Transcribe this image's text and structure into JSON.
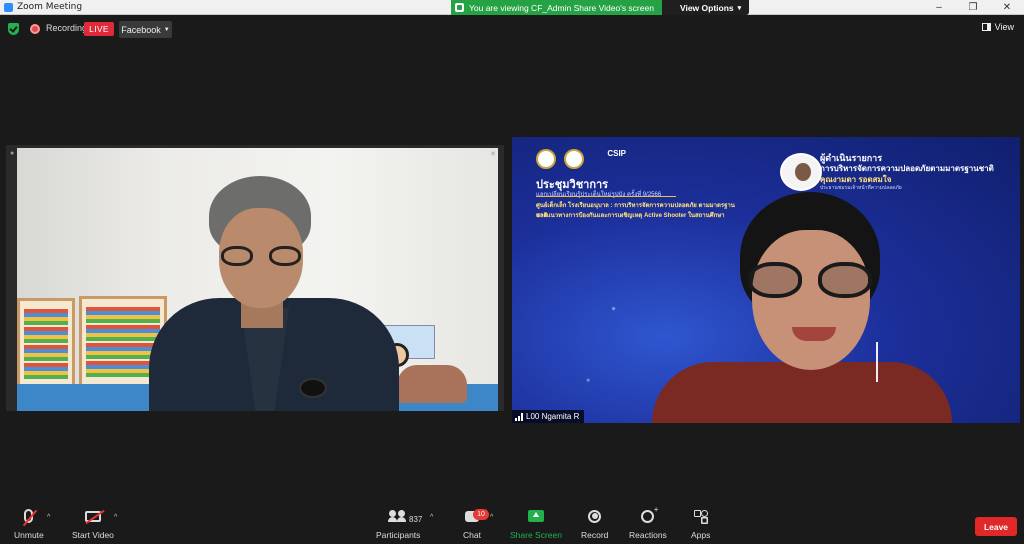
{
  "window": {
    "title": "Zoom Meeting",
    "controls": [
      "–",
      "❐",
      "✕"
    ]
  },
  "share_banner": {
    "message": "You are viewing CF_Admin Share Video's screen",
    "view_options": "View Options",
    "color": "#25a244"
  },
  "topbar": {
    "recording_label": "Recording",
    "live_badge": "LIVE",
    "stream_target": "Facebook",
    "view_label": "View"
  },
  "tiles": {
    "right": {
      "participant_name": "L00 Ngamita R",
      "slide": {
        "logo_text": "CSIP",
        "title": "ประชุมวิชาการ",
        "subtitle": "แลกเปลี่ยนเรียนรู้ประเด็นใหม่รูปบัง ครั้งที่ 9/2566",
        "topic_line1": "ศูนย์เด็กเล็ก โรงเรียนอนุบาล : การบริหารจัดการความปลอดภัย ตามมาตรฐานชาติ",
        "topic_line2": "และแนวทางการป้องกันและการเผชิญเหตุ Active Shooter ในสถานศึกษา",
        "host_role": "ผู้ดำเนินรายการ",
        "host_topic": "การบริหารจัดการความปลอดภัยตามมาตรฐานชาติ",
        "host_name": "คุณงามตา รอดสมใจ",
        "host_detail": "ประธานชมรมเจ้าหน้าที่ความปลอดภัย"
      }
    }
  },
  "toolbar": {
    "unmute": "Unmute",
    "start_video": "Start Video",
    "participants": "Participants",
    "participants_count": "837",
    "chat": "Chat",
    "chat_badge": "10",
    "share_screen": "Share Screen",
    "record": "Record",
    "reactions": "Reactions",
    "apps": "Apps",
    "leave": "Leave",
    "caret": "^"
  },
  "colors": {
    "live": "#e02a3a",
    "share": "#23b14d",
    "leave": "#e02828",
    "background": "#1a1a1a"
  },
  "icons": [
    "zoom-app-icon",
    "shield-icon",
    "record-dot-icon",
    "view-grid-icon",
    "mic-muted-icon",
    "camera-off-icon",
    "participants-icon",
    "chat-icon",
    "share-screen-icon",
    "record-icon",
    "reactions-icon",
    "apps-icon",
    "signal-bars-icon"
  ]
}
